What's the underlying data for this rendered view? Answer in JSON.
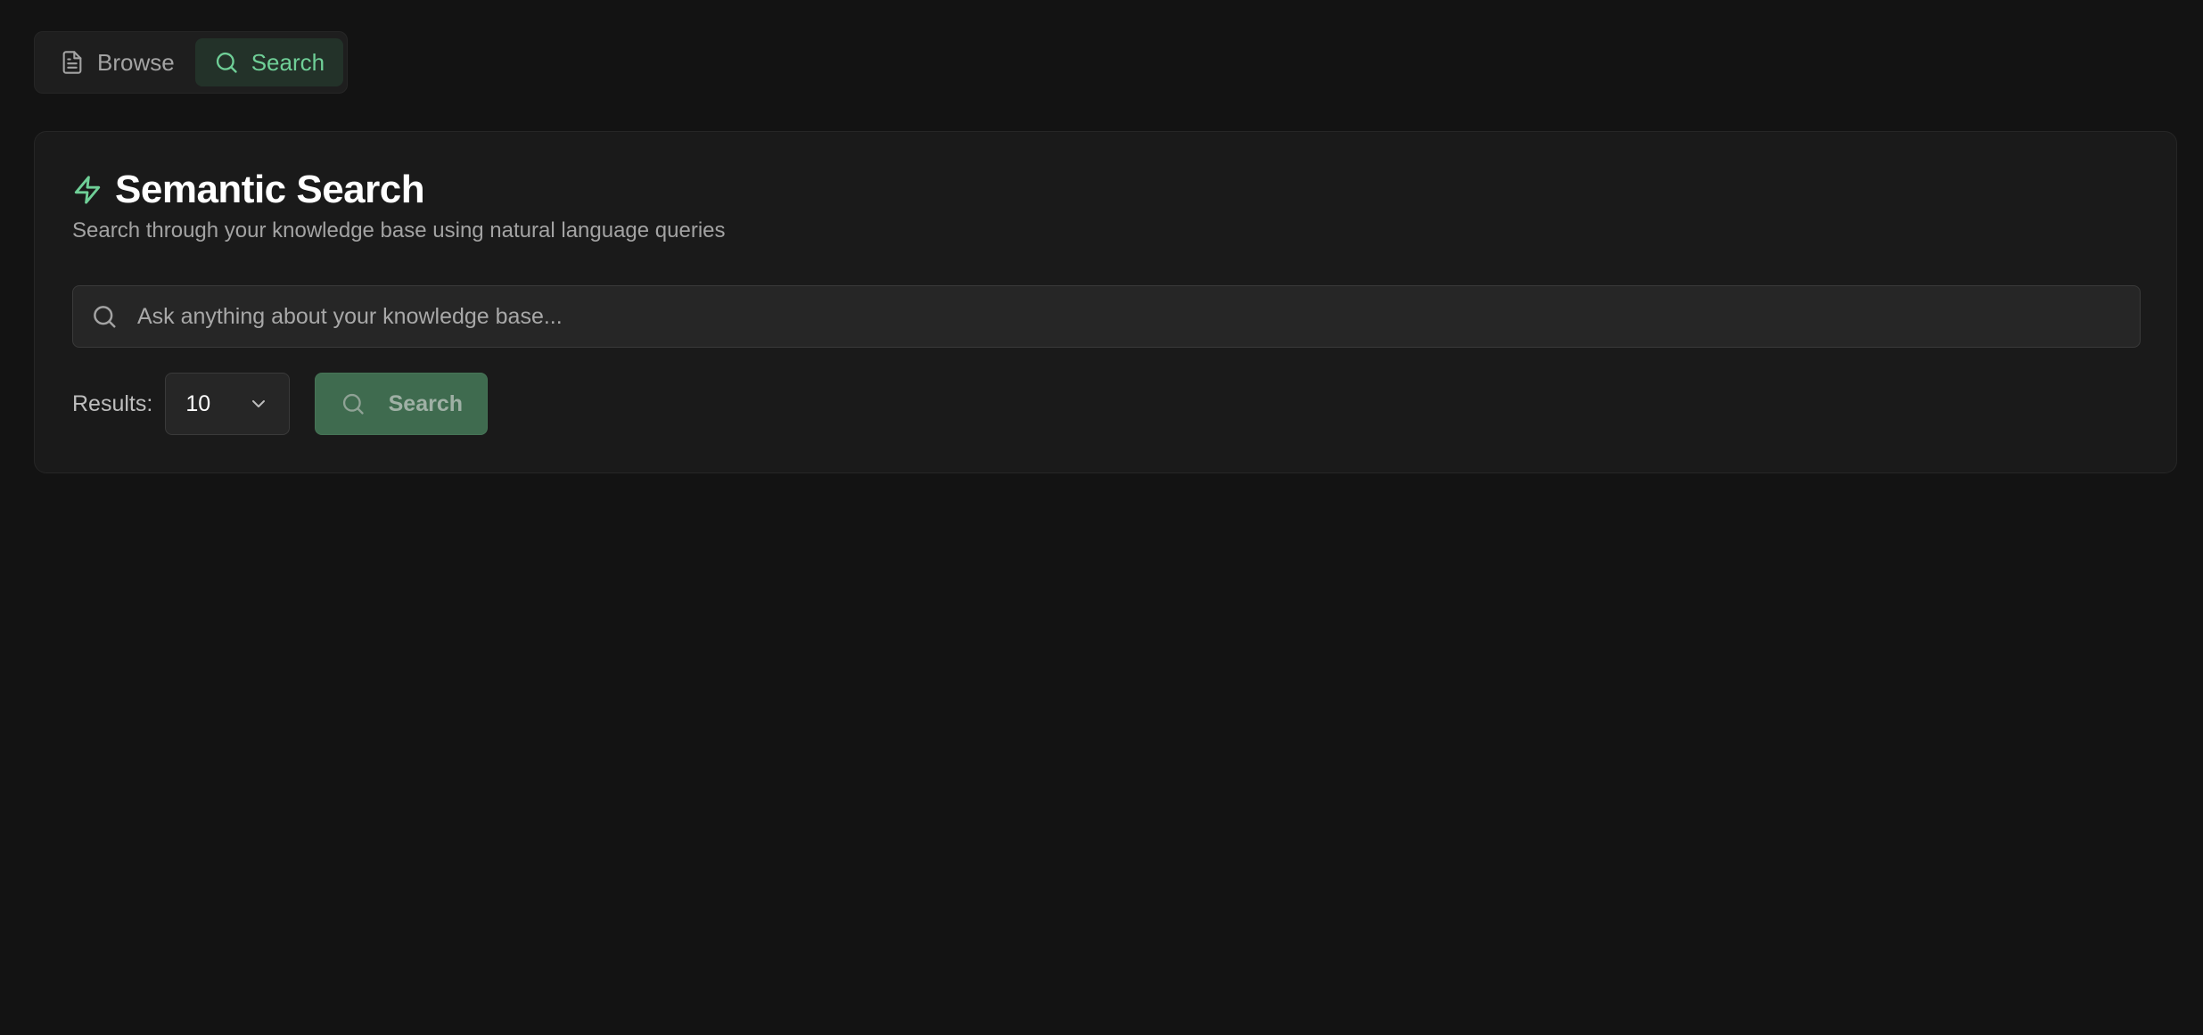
{
  "tabs": [
    {
      "label": "Browse",
      "icon": "document-icon",
      "active": false
    },
    {
      "label": "Search",
      "icon": "search-icon",
      "active": true
    }
  ],
  "panel": {
    "title": "Semantic Search",
    "title_icon": "lightning-icon",
    "subtitle": "Search through your knowledge base using natural language queries",
    "search": {
      "placeholder": "Ask anything about your knowledge base...",
      "value": ""
    },
    "results_label": "Results:",
    "results_value": "10",
    "search_button_label": "Search"
  },
  "colors": {
    "background": "#131313",
    "accent": "#6fcf97",
    "button": "#3f6b4f"
  }
}
